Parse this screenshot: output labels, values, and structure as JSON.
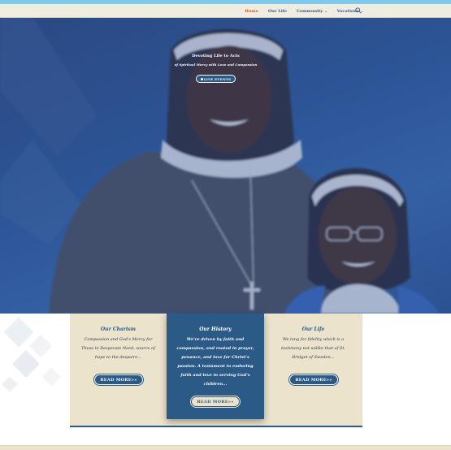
{
  "nav": {
    "items": [
      {
        "label": "Home",
        "active": true,
        "has_dropdown": false
      },
      {
        "label": "Our Life",
        "active": false,
        "has_dropdown": false
      },
      {
        "label": "Community",
        "active": false,
        "has_dropdown": true
      },
      {
        "label": "Vocations",
        "active": false,
        "has_dropdown": true
      }
    ],
    "search_icon": "search-icon",
    "colors": {
      "active": "#d65a2a",
      "link": "#345a8a",
      "bar": "#f0ece0",
      "top_strip": "#7ec9ee"
    }
  },
  "hero": {
    "title": "Devoting Life to Acts",
    "subtitle": "of Spiritual Mercy with Love and Compassion",
    "button_label": "LIVE EVENTS"
  },
  "cards": [
    {
      "title": "Our Charism",
      "lines": [
        "Compassion and God's Mercy for",
        "Those in Desperate Need, source of",
        "hope to the despaire..."
      ],
      "button_label": "READ MORE»»"
    },
    {
      "title": "Our History",
      "lines": [
        "We're driven by faith and",
        "compassion, and rooted in prayer,",
        "penance, and love for Christ's",
        "passion. A testament to enduring",
        "faith and love in serving God's",
        "children..."
      ],
      "button_label": "READ MORE»»"
    },
    {
      "title": "Our Life",
      "lines": [
        "We long for fidelity which is a",
        "testimony not unlike that of St.",
        "Bridget of Sweden..."
      ],
      "button_label": "READ MORE»»"
    }
  ],
  "colors": {
    "brand_blue": "#2b5a86",
    "cream": "#ebe3cc"
  }
}
